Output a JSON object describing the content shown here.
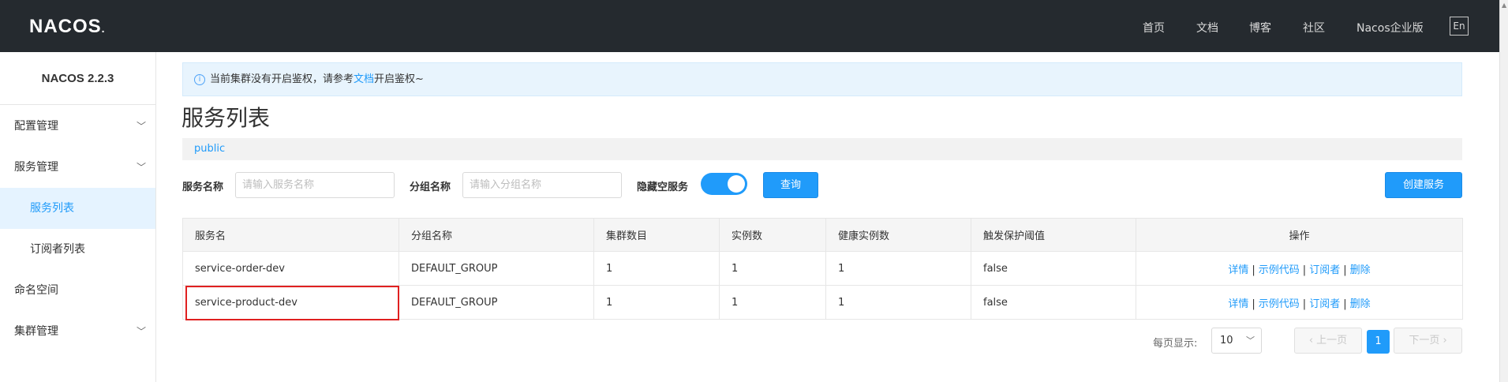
{
  "header": {
    "logo": "NACOS",
    "logo_dot": ".",
    "nav": [
      "首页",
      "文档",
      "博客",
      "社区",
      "Nacos企业版"
    ],
    "lang_button": "En"
  },
  "sidebar": {
    "version": "NACOS 2.2.3",
    "items": [
      {
        "label": "配置管理",
        "expandable": true
      },
      {
        "label": "服务管理",
        "expandable": true
      },
      {
        "label": "服务列表",
        "active": true
      },
      {
        "label": "订阅者列表"
      },
      {
        "label": "命名空间"
      },
      {
        "label": "集群管理",
        "expandable": true
      }
    ]
  },
  "notice": {
    "icon": "info-icon",
    "text_before": "当前集群没有开启鉴权，请参考",
    "link": "文档",
    "text_after": "开启鉴权~"
  },
  "page": {
    "title": "服务列表",
    "namespace": "public"
  },
  "filters": {
    "service_name_label": "服务名称",
    "service_name_placeholder": "请输入服务名称",
    "group_name_label": "分组名称",
    "group_name_placeholder": "请输入分组名称",
    "hide_empty_label": "隐藏空服务",
    "hide_empty_on": true,
    "query_button": "查询",
    "create_button": "创建服务"
  },
  "table": {
    "columns": [
      "服务名",
      "分组名称",
      "集群数目",
      "实例数",
      "健康实例数",
      "触发保护阈值",
      "操作"
    ],
    "rows": [
      {
        "name": "service-order-dev",
        "group": "DEFAULT_GROUP",
        "clusters": "1",
        "instances": "1",
        "healthy": "1",
        "threshold": "false"
      },
      {
        "name": "service-product-dev",
        "group": "DEFAULT_GROUP",
        "clusters": "1",
        "instances": "1",
        "healthy": "1",
        "threshold": "false"
      }
    ],
    "ops": [
      "详情",
      "示例代码",
      "订阅者",
      "删除"
    ],
    "op_separator": "|"
  },
  "pagination": {
    "page_size_label": "每页显示:",
    "page_size": "10",
    "prev": "上一页",
    "next": "下一页",
    "current_page": "1"
  },
  "colors": {
    "topbar": "#252a2f",
    "accent": "#209bfa",
    "highlight_border": "#e02020"
  }
}
